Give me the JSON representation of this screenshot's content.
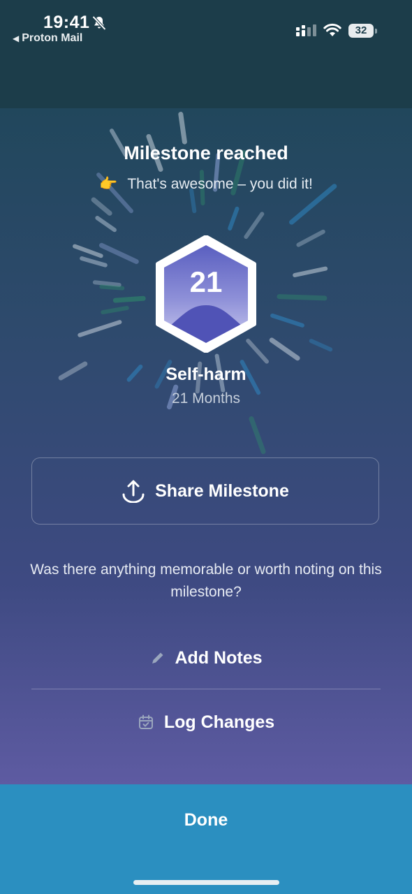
{
  "status_bar": {
    "time": "19:41",
    "back_app": "Proton Mail",
    "battery": "32",
    "icons": [
      "bell-slash-icon",
      "signal-icon",
      "wifi-icon",
      "battery-icon"
    ]
  },
  "milestone": {
    "title": "Milestone reached",
    "subtitle_emoji": "👉",
    "subtitle": "That's awesome – you did it!",
    "badge_number": "21",
    "habit": "Self-harm",
    "duration": "21 Months"
  },
  "actions": {
    "share_label": "Share Milestone",
    "question": "Was there anything memorable or worth noting on this milestone?",
    "add_notes": "Add Notes",
    "log_changes": "Log Changes",
    "done": "Done"
  },
  "colors": {
    "header_bg": "#1c3d4a",
    "gradient_top": "#21475c",
    "gradient_bottom": "#5e5ba2",
    "badge_fill": "#6f70c9",
    "done_bg": "#2b8fc0",
    "burst_green": "#2f8f6a",
    "burst_blue": "#2f86c2"
  }
}
